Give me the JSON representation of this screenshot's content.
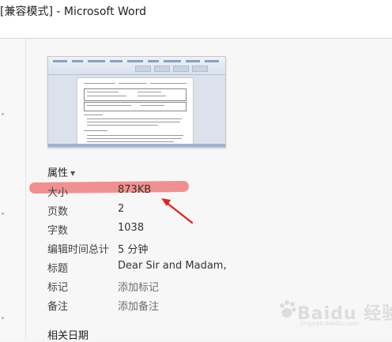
{
  "window": {
    "title": "[兼容模式] - Microsoft Word"
  },
  "properties": {
    "header": "属性",
    "rows": [
      {
        "key": "大小",
        "value": "873KB"
      },
      {
        "key": "页数",
        "value": "2"
      },
      {
        "key": "字数",
        "value": "1038"
      },
      {
        "key": "编辑时间总计",
        "value": "5 分钟"
      },
      {
        "key": "标题",
        "value": "Dear Sir and Madam,"
      },
      {
        "key": "标记",
        "value": "添加标记"
      },
      {
        "key": "备注",
        "value": "添加备注"
      }
    ]
  },
  "related_dates": {
    "header": "相关日期"
  },
  "watermark": {
    "text": "Baidu 经验",
    "subtext": "jingyan.baidu.com"
  },
  "colors": {
    "highlight": "#f08a8a",
    "arrow": "#e02020"
  }
}
